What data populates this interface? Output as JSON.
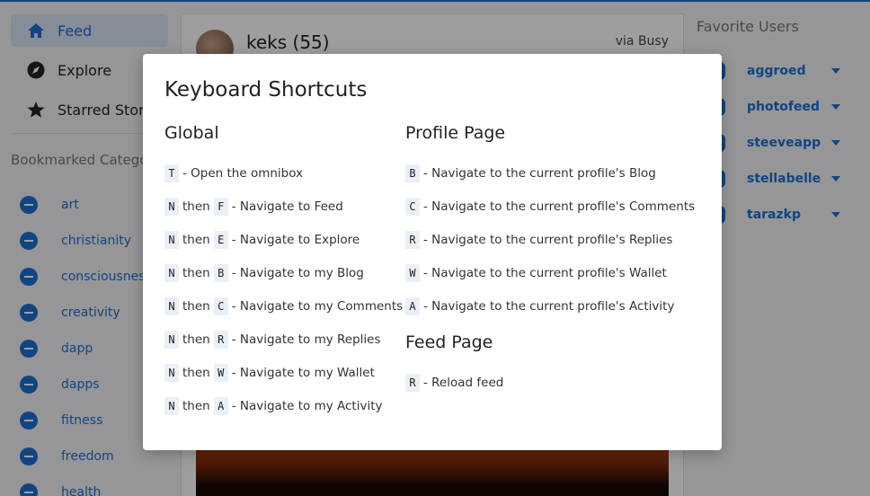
{
  "sidebar": {
    "nav": [
      {
        "label": "Feed",
        "icon": "home-icon",
        "active": true
      },
      {
        "label": "Explore",
        "icon": "compass-icon",
        "active": false
      },
      {
        "label": "Starred Stories",
        "icon": "star-icon",
        "active": false
      }
    ],
    "bookmarked_title": "Bookmarked Categories",
    "categories": [
      "art",
      "christianity",
      "consciousness",
      "creativity",
      "dapp",
      "dapps",
      "fitness",
      "freedom",
      "health"
    ]
  },
  "post": {
    "author": "keks (55)",
    "via": "via Busy"
  },
  "favorites": {
    "title": "Favorite Users",
    "users": [
      "aggroed",
      "photofeed",
      "steeveapp",
      "stellabelle",
      "tarazkp"
    ]
  },
  "modal": {
    "title": "Keyboard Shortcuts",
    "global": {
      "title": "Global",
      "items": [
        {
          "keys": [
            "T"
          ],
          "desc": "- Open the omnibox"
        },
        {
          "keys": [
            "N",
            "F"
          ],
          "desc": "- Navigate to Feed"
        },
        {
          "keys": [
            "N",
            "E"
          ],
          "desc": "- Navigate to Explore"
        },
        {
          "keys": [
            "N",
            "B"
          ],
          "desc": "- Navigate to my Blog"
        },
        {
          "keys": [
            "N",
            "C"
          ],
          "desc": "- Navigate to my Comments"
        },
        {
          "keys": [
            "N",
            "R"
          ],
          "desc": "- Navigate to my Replies"
        },
        {
          "keys": [
            "N",
            "W"
          ],
          "desc": "- Navigate to my Wallet"
        },
        {
          "keys": [
            "N",
            "A"
          ],
          "desc": "- Navigate to my Activity"
        }
      ]
    },
    "then_word": "then",
    "profile": {
      "title": "Profile Page",
      "items": [
        {
          "keys": [
            "B"
          ],
          "desc": "- Navigate to the current profile's Blog"
        },
        {
          "keys": [
            "C"
          ],
          "desc": "- Navigate to the current profile's Comments"
        },
        {
          "keys": [
            "R"
          ],
          "desc": "- Navigate to the current profile's Replies"
        },
        {
          "keys": [
            "W"
          ],
          "desc": "- Navigate to the current profile's Wallet"
        },
        {
          "keys": [
            "A"
          ],
          "desc": "- Navigate to the current profile's Activity"
        }
      ]
    },
    "feed": {
      "title": "Feed Page",
      "items": [
        {
          "keys": [
            "R"
          ],
          "desc": "- Reload feed"
        }
      ]
    }
  },
  "colors": {
    "accent": "#1e6fd0",
    "active_bg": "#d6e4f5",
    "key_bg": "#eaf0f7"
  }
}
